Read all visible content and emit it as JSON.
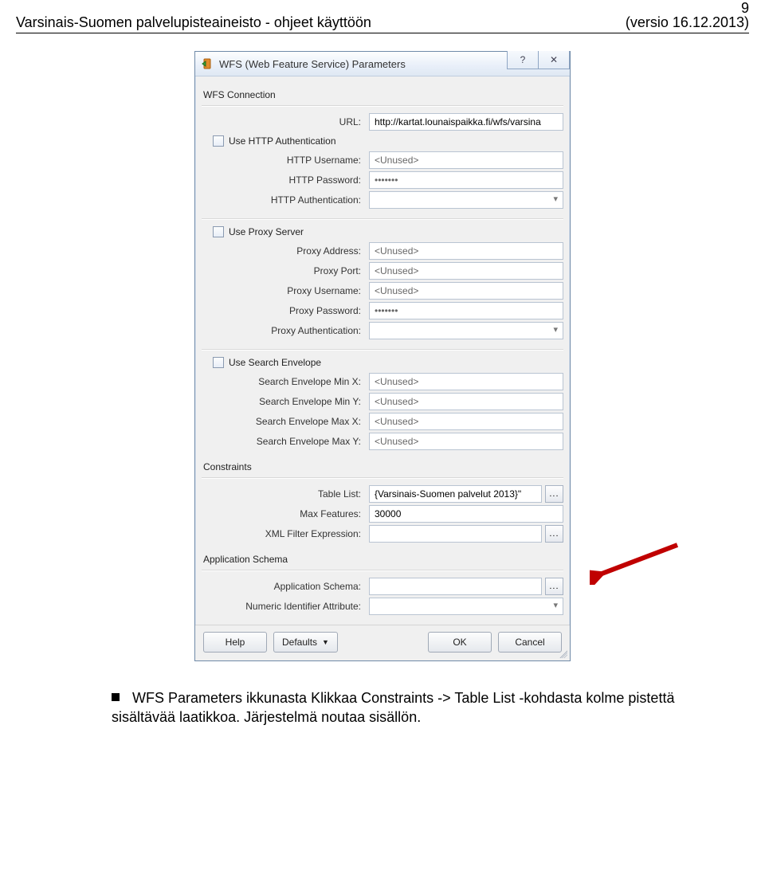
{
  "page": {
    "number": "9",
    "header_left": "Varsinais-Suomen palvelupisteaineisto - ohjeet käyttöön",
    "header_right": "(versio 16.12.2013)"
  },
  "dialog": {
    "title": "WFS (Web Feature Service) Parameters",
    "win_help_glyph": "?",
    "win_close_glyph": "✕",
    "groups": {
      "wfs_connection": {
        "label": "WFS Connection",
        "url_label": "URL:",
        "url_value": "http://kartat.lounaispaikka.fi/wfs/varsina",
        "use_http_auth_label": "Use HTTP Authentication",
        "http_user_label": "HTTP Username:",
        "http_user_value": "<Unused>",
        "http_pass_label": "HTTP Password:",
        "http_pass_value": "•••••••",
        "http_auth_label": "HTTP Authentication:"
      },
      "proxy": {
        "use_proxy_label": "Use Proxy Server",
        "addr_label": "Proxy Address:",
        "addr_value": "<Unused>",
        "port_label": "Proxy Port:",
        "port_value": "<Unused>",
        "user_label": "Proxy Username:",
        "user_value": "<Unused>",
        "pass_label": "Proxy Password:",
        "pass_value": "•••••••",
        "auth_label": "Proxy Authentication:"
      },
      "search_env": {
        "use_label": "Use Search Envelope",
        "minx_label": "Search Envelope Min X:",
        "minx_value": "<Unused>",
        "miny_label": "Search Envelope Min Y:",
        "miny_value": "<Unused>",
        "maxx_label": "Search Envelope Max X:",
        "maxx_value": "<Unused>",
        "maxy_label": "Search Envelope Max Y:",
        "maxy_value": "<Unused>"
      },
      "constraints": {
        "label": "Constraints",
        "table_list_label": "Table List:",
        "table_list_value": "{Varsinais-Suomen palvelut 2013}\"",
        "max_feat_label": "Max Features:",
        "max_feat_value": "30000",
        "xml_filter_label": "XML Filter Expression:"
      },
      "app_schema": {
        "label": "Application Schema",
        "schema_label": "Application Schema:",
        "numid_label": "Numeric Identifier Attribute:"
      }
    },
    "buttons": {
      "help": "Help",
      "defaults": "Defaults",
      "ok": "OK",
      "cancel": "Cancel"
    },
    "ellipsis": "..."
  },
  "caption": {
    "text": "WFS Parameters ikkunasta Klikkaa Constraints -> Table List -kohdasta kolme pistettä sisältävää laatikkoa. Järjestelmä noutaa sisällön."
  }
}
